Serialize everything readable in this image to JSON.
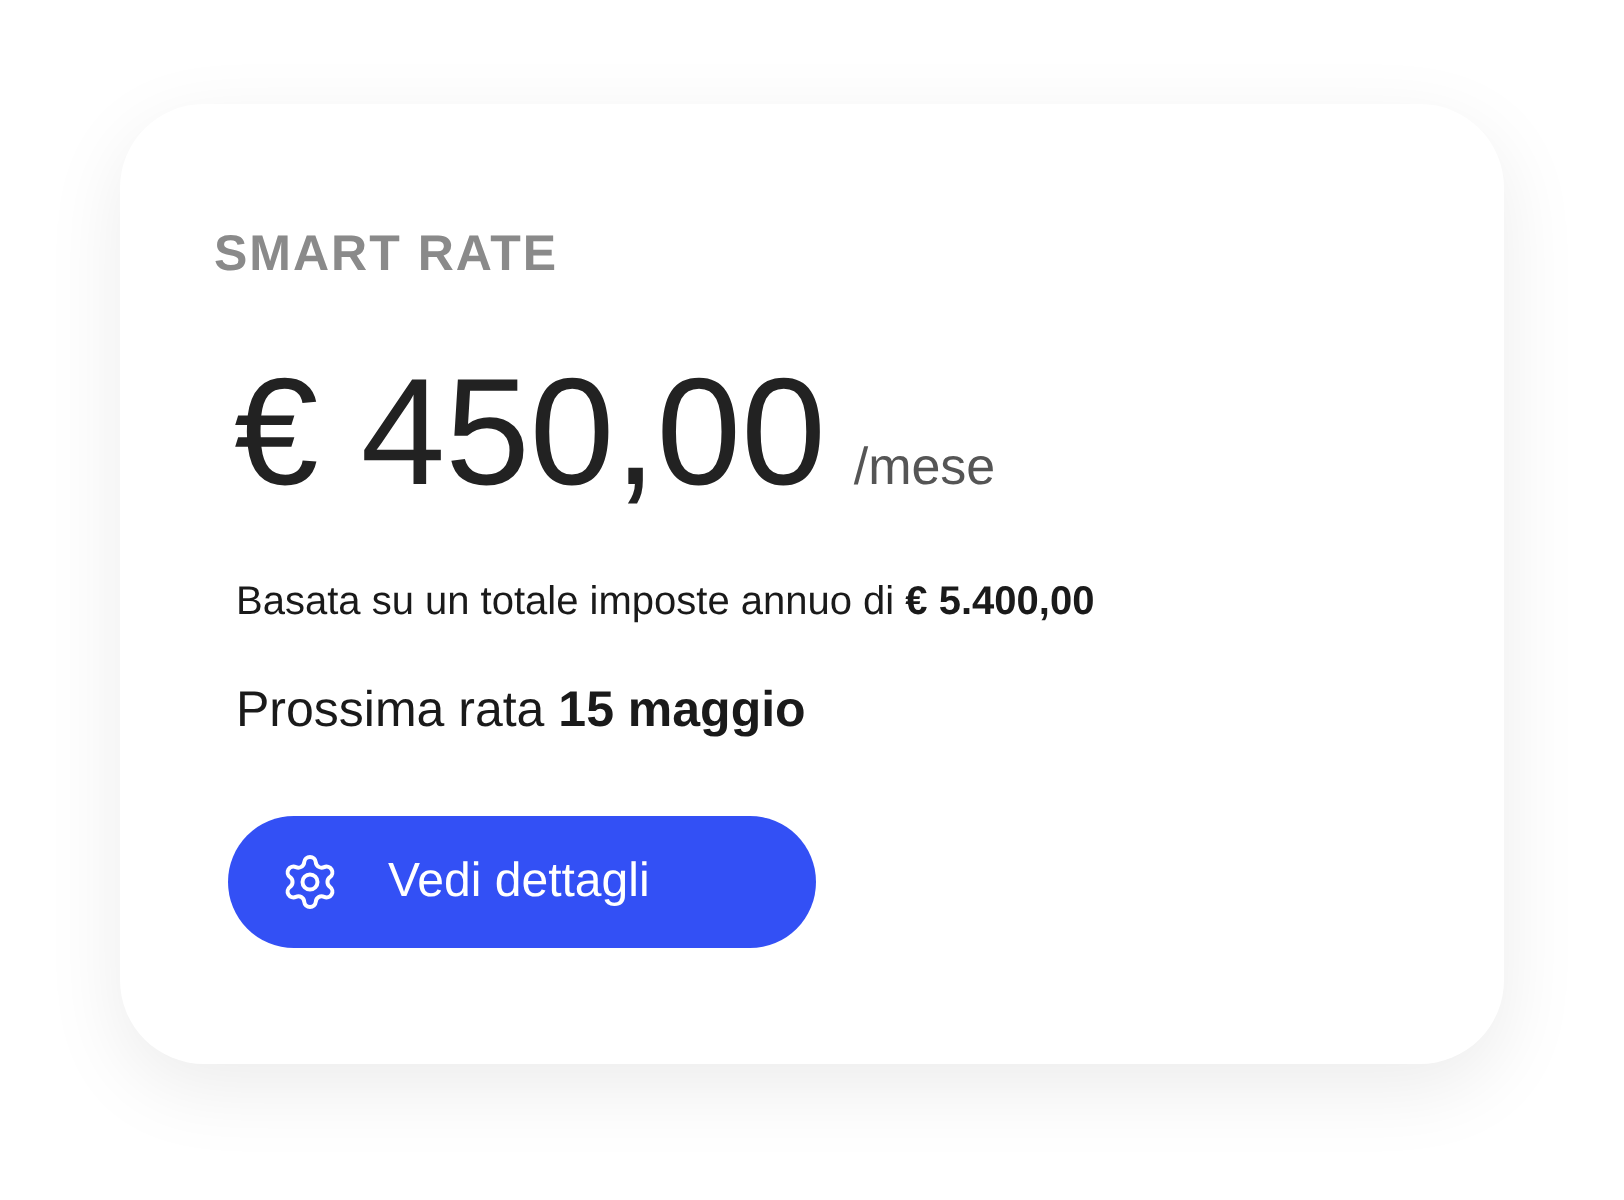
{
  "card": {
    "title": "SMART RATE",
    "amount": "€ 450,00",
    "period": "/mese",
    "summary": "Basata su un totale imposte annuo di **€ 5.400,00**",
    "next_installment": "Prossima rata **15 maggio**",
    "button": {
      "label": "Vedi dettagli"
    }
  }
}
